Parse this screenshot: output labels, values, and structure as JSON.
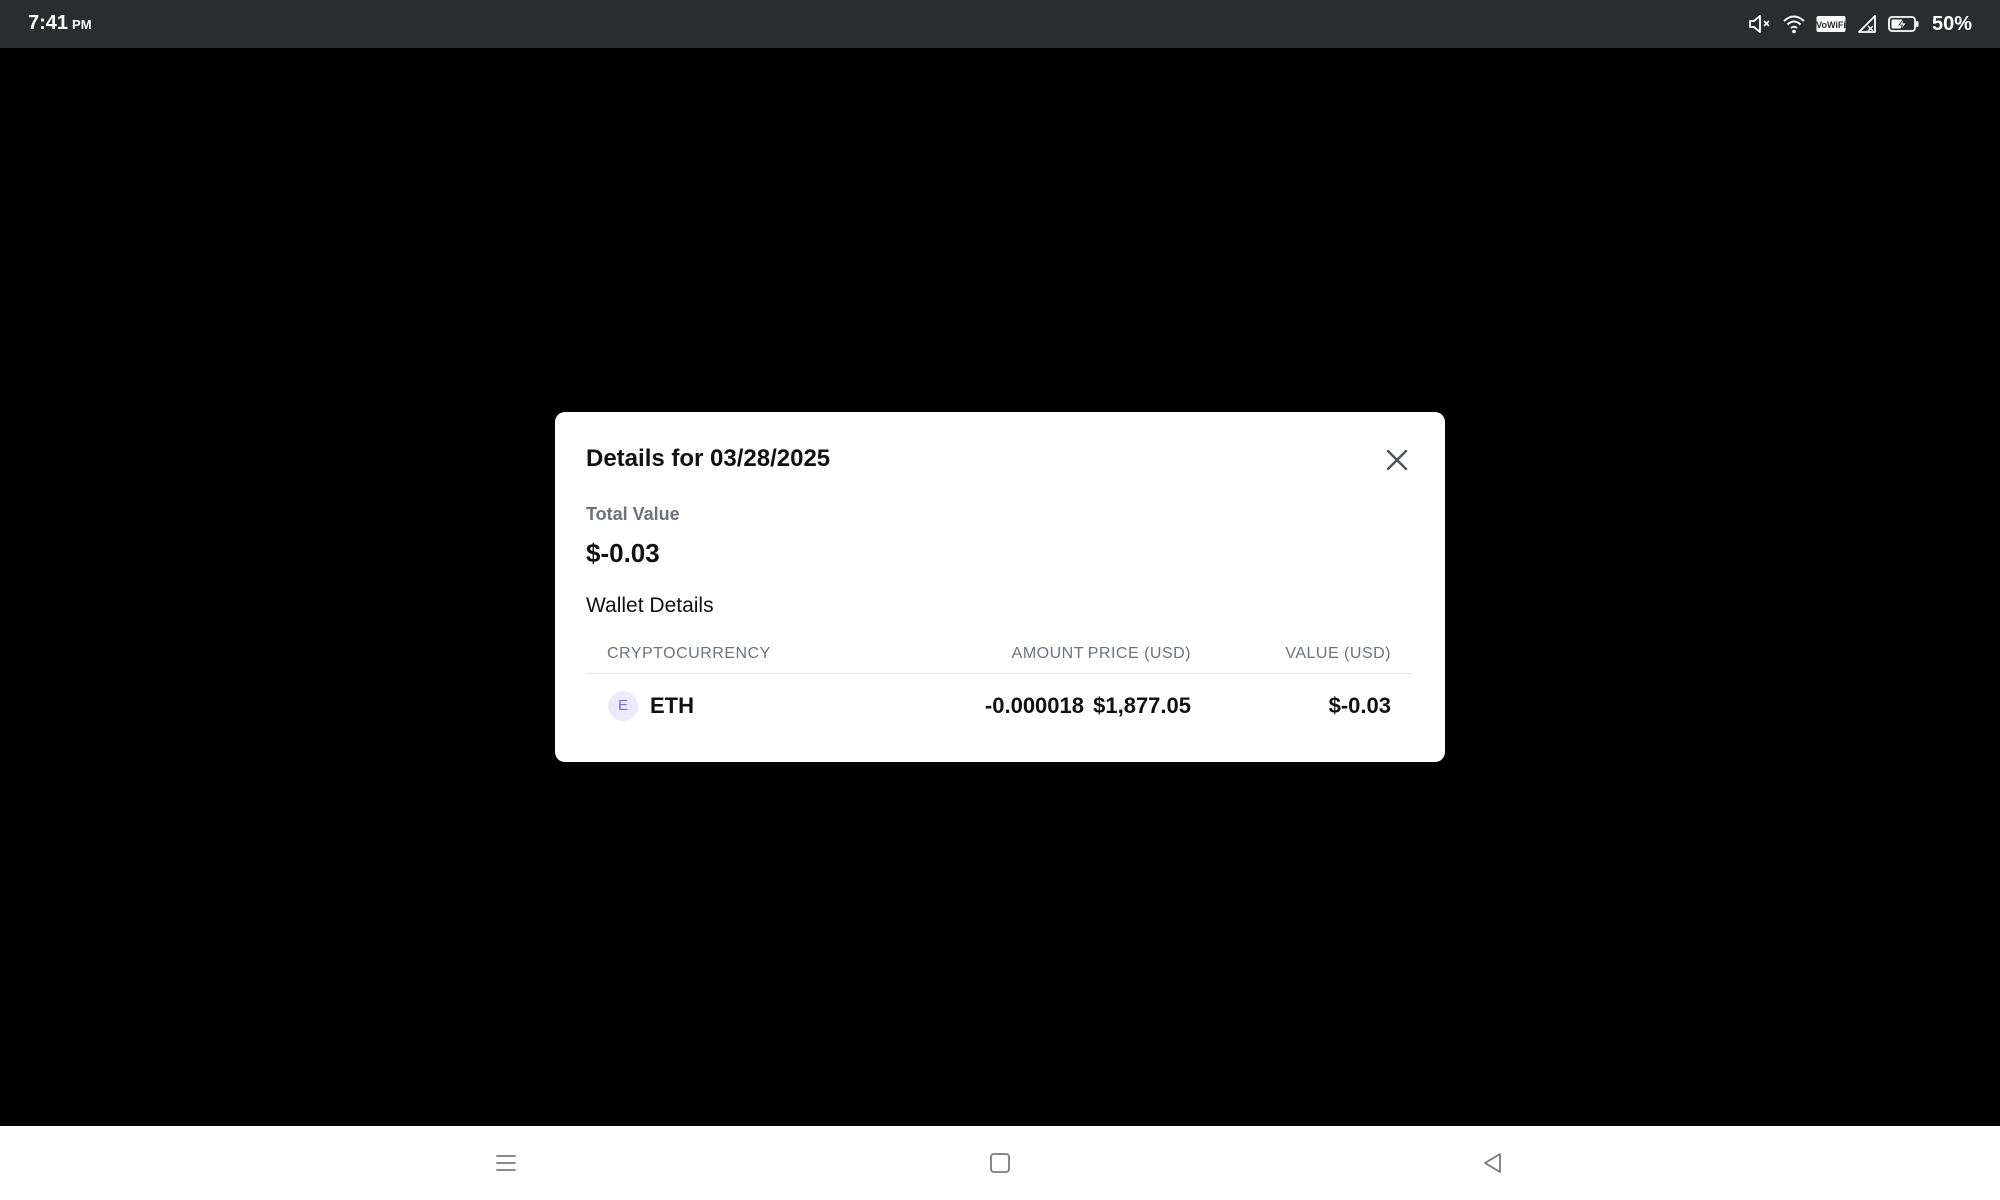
{
  "status_bar": {
    "time": "7:41",
    "ampm": "PM",
    "battery_percent": "50%",
    "icons": [
      "mute-icon",
      "wifi-icon",
      "vowifi-icon",
      "no-signal-icon",
      "battery-charging-icon"
    ],
    "vowifi_label": "VoWiFi"
  },
  "modal": {
    "title": "Details for 03/28/2025",
    "close_icon": "close-icon",
    "total_label": "Total Value",
    "total_value": "$-0.03",
    "wallet_heading": "Wallet Details",
    "table": {
      "headers": {
        "crypto": "CRYPTOCURRENCY",
        "amount": "AMOUNT",
        "price": "PRICE (USD)",
        "value": "VALUE (USD)"
      },
      "rows": [
        {
          "avatar_letter": "E",
          "symbol": "ETH",
          "amount": "-0.000018",
          "price": "$1,877.05",
          "value": "$-0.03"
        }
      ]
    }
  },
  "nav_bar": {
    "icons": [
      "menu-icon",
      "home-icon",
      "back-icon"
    ]
  },
  "colors": {
    "status_bar_bg": "#2b2c2e",
    "backdrop": "#000000",
    "modal_bg": "#ffffff",
    "muted_text": "#6b7280",
    "avatar_bg": "#ede9fe",
    "avatar_fg": "#7c6fd8"
  }
}
